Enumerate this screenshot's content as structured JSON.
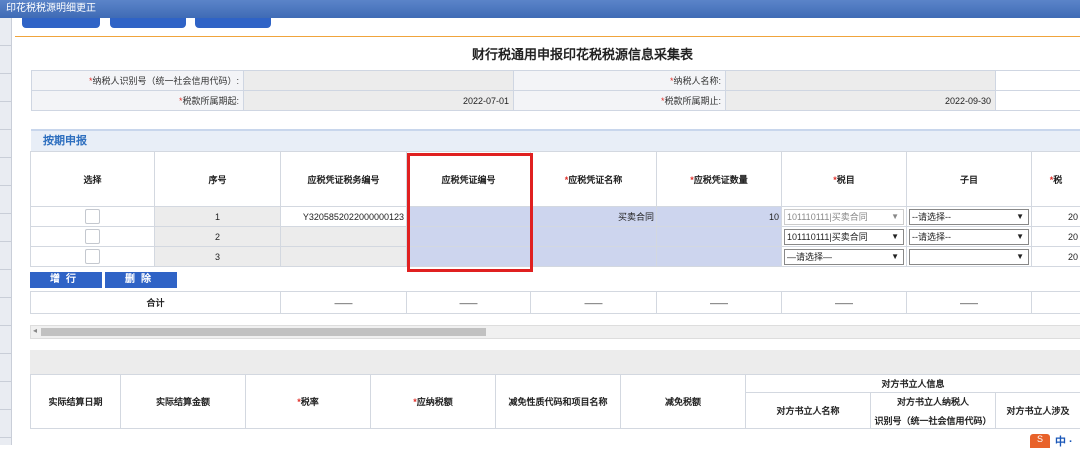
{
  "window": {
    "title": "印花税税源明细更正"
  },
  "page_title": "财行税通用申报印花税税源信息采集表",
  "taxpayer": {
    "id_label": "纳税人识别号（统一社会信用代码）:",
    "id_value": "",
    "name_label": "纳税人名称:",
    "name_value": "",
    "period_start_label": "税款所属期起:",
    "period_start_value": "2022-07-01",
    "period_end_label": "税款所属期止:",
    "period_end_value": "2022-09-30"
  },
  "section": {
    "title": "按期申报"
  },
  "grid": {
    "headers": {
      "select": "选择",
      "seq": "序号",
      "voucher_tax_no": "应税凭证税务编号",
      "voucher_no": "应税凭证编号",
      "voucher_name": "应税凭证名称",
      "voucher_qty": "应税凭证数量",
      "tax_item": "税目",
      "sub_item": "子目",
      "tax_trunc": "税"
    },
    "rows": [
      {
        "seq": "1",
        "voucher_tax_no": "Y3205852022000000123",
        "voucher_no": "",
        "voucher_name": "买卖合同",
        "voucher_qty": "10",
        "tax_item": "101110111|买卖合同",
        "sub_item": "--请选择--",
        "tax_trunc": "20"
      },
      {
        "seq": "2",
        "voucher_tax_no": "",
        "voucher_no": "",
        "voucher_name": "",
        "voucher_qty": "",
        "tax_item": "101110111|买卖合同",
        "sub_item": "--请选择--",
        "tax_trunc": "20"
      },
      {
        "seq": "3",
        "voucher_tax_no": "",
        "voucher_no": "",
        "voucher_name": "",
        "voucher_qty": "",
        "tax_item": "—请选择—",
        "sub_item": "",
        "tax_trunc": "20"
      }
    ]
  },
  "buttons": {
    "add_row": "增行",
    "delete_row": "删除"
  },
  "summary": {
    "label": "合计",
    "dash": "——"
  },
  "bottom_grid": {
    "actual_date": "实际结算日期",
    "actual_amount": "实际结算金额",
    "tax_rate": "税率",
    "tax_payable": "应纳税额",
    "reduction_code": "减免性质代码和项目名称",
    "reduction_amount": "减免税额",
    "counterparty_info": "对方书立人信息",
    "counterparty_name": "对方书立人名称",
    "counterparty_id_line1": "对方书立人纳税人",
    "counterparty_id_line2": "识别号（统一社会信用代码）",
    "counterparty_amount": "对方书立人涉及"
  },
  "footer_badge": {
    "icon_char": "S",
    "text": "中 ·"
  },
  "colors": {
    "accent": "#2f63c6",
    "highlight": "#cdd5ee",
    "required": "#e0302a",
    "annotation": "#e02020"
  }
}
